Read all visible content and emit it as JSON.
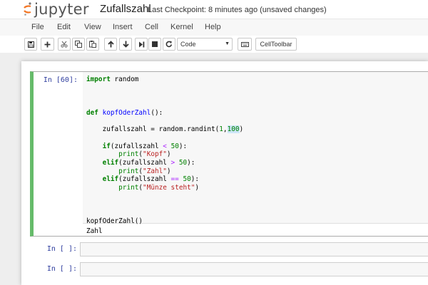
{
  "header": {
    "logo_text": "jupyter",
    "notebook_name": "Zufallszahl",
    "checkpoint": "Last Checkpoint: 8 minutes ago (unsaved changes)"
  },
  "menu": {
    "items": [
      "File",
      "Edit",
      "View",
      "Insert",
      "Cell",
      "Kernel",
      "Help"
    ]
  },
  "toolbar": {
    "buttons": [
      "save-icon",
      "add-icon",
      "cut-icon",
      "copy-icon",
      "paste-icon",
      "move-up-icon",
      "move-down-icon",
      "run-icon",
      "stop-icon",
      "restart-icon"
    ],
    "cell_type": "Code",
    "keyboard_icon": "keyboard-icon",
    "celltoolbar_label": "CellToolbar"
  },
  "cells": [
    {
      "prompt": "In [60]:",
      "code_lines": [
        "import random",
        "",
        "",
        "",
        "def kopfOderZahl():",
        "",
        "    zufallszahl = random.randint(1,100)",
        "",
        "    if(zufallszahl < 50):",
        "        print(\"Kopf\")",
        "    elif(zufallszahl > 50):",
        "        print(\"Zahl\")",
        "    elif(zufallszahl == 50):",
        "        print(\"Münze steht\")",
        "",
        "",
        "",
        "kopfOderZahl()"
      ],
      "output": "Zahl"
    },
    {
      "prompt": "In [ ]:"
    },
    {
      "prompt": "In [ ]:"
    }
  ],
  "colors": {
    "selected_cell_border": "#66bb6a",
    "prompt": "#303f9f",
    "keyword": "#008000",
    "function_name": "#0000ff",
    "string": "#ba2121",
    "operator": "#aa22ff"
  }
}
